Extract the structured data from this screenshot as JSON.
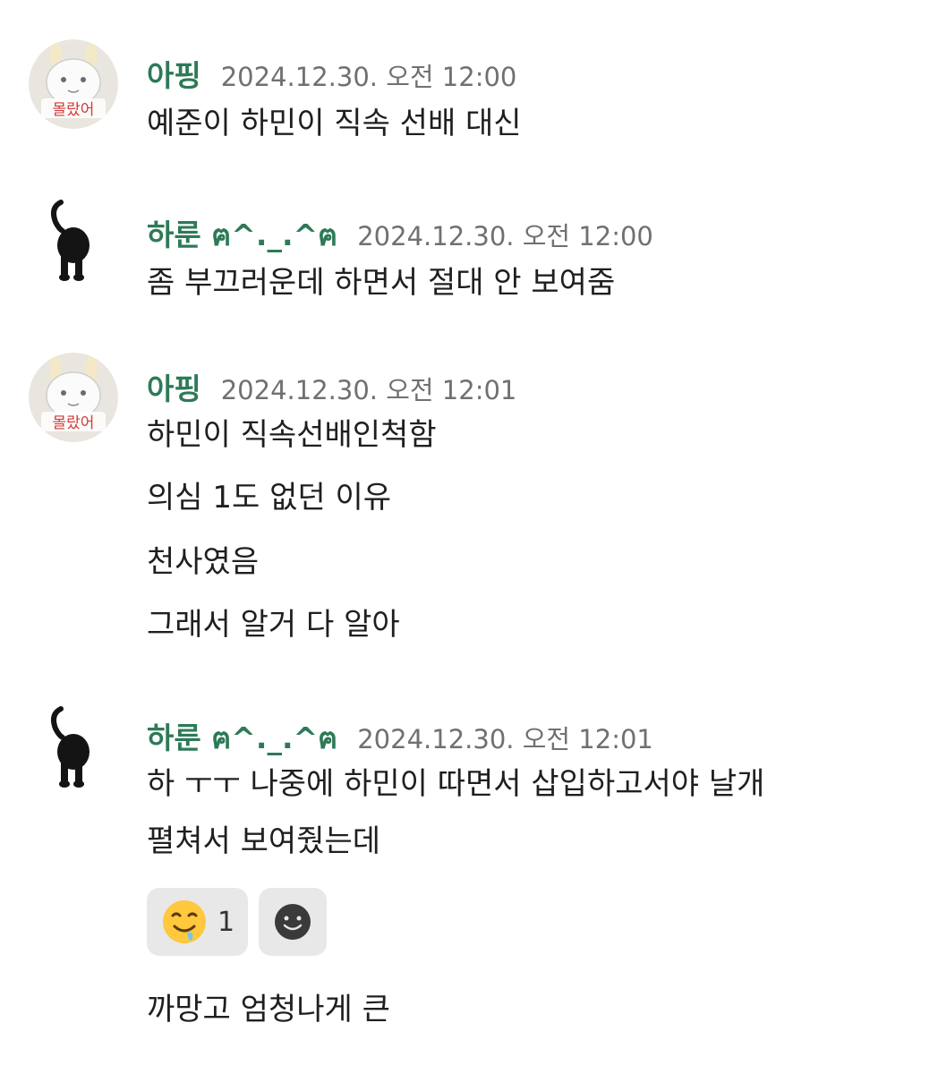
{
  "colors": {
    "username": "#2e7a57",
    "timestamp": "#707070",
    "text": "#1f1f1f",
    "reaction_bg": "#e8e8e8"
  },
  "messages": [
    {
      "user": "아핑",
      "avatar": "bunny-avatar-icon",
      "avatar_caption": "몰랐어",
      "time": "2024.12.30. 오전 12:00",
      "lines": [
        "예준이 하민이 직속 선배 대신"
      ]
    },
    {
      "user": "하룬 ฅ^._.^ฅ",
      "avatar": "black-cat-avatar-icon",
      "time": "2024.12.30. 오전 12:00",
      "lines": [
        "좀 부끄러운데 하면서 절대 안 보여줌"
      ]
    },
    {
      "user": "아핑",
      "avatar": "bunny-avatar-icon",
      "avatar_caption": "몰랐어",
      "time": "2024.12.30. 오전 12:01",
      "lines": [
        "하민이 직속선배인척함",
        "의심 1도 없던 이유",
        "천사였음",
        "그래서 알거 다 알아"
      ]
    },
    {
      "user": "하룬 ฅ^._.^ฅ",
      "avatar": "black-cat-avatar-icon",
      "time": "2024.12.30. 오전 12:01",
      "lines": [
        "하 ㅜㅜ 나중에 하민이 따면서 삽입하고서야 날개",
        "펼쳐서 보여줬는데"
      ],
      "reactions": [
        {
          "emoji": "drooling-face-icon",
          "count": "1"
        },
        {
          "emoji": "add-reaction-smiley-icon"
        }
      ],
      "followup": [
        "까망고 엄청나게 큰"
      ]
    }
  ]
}
